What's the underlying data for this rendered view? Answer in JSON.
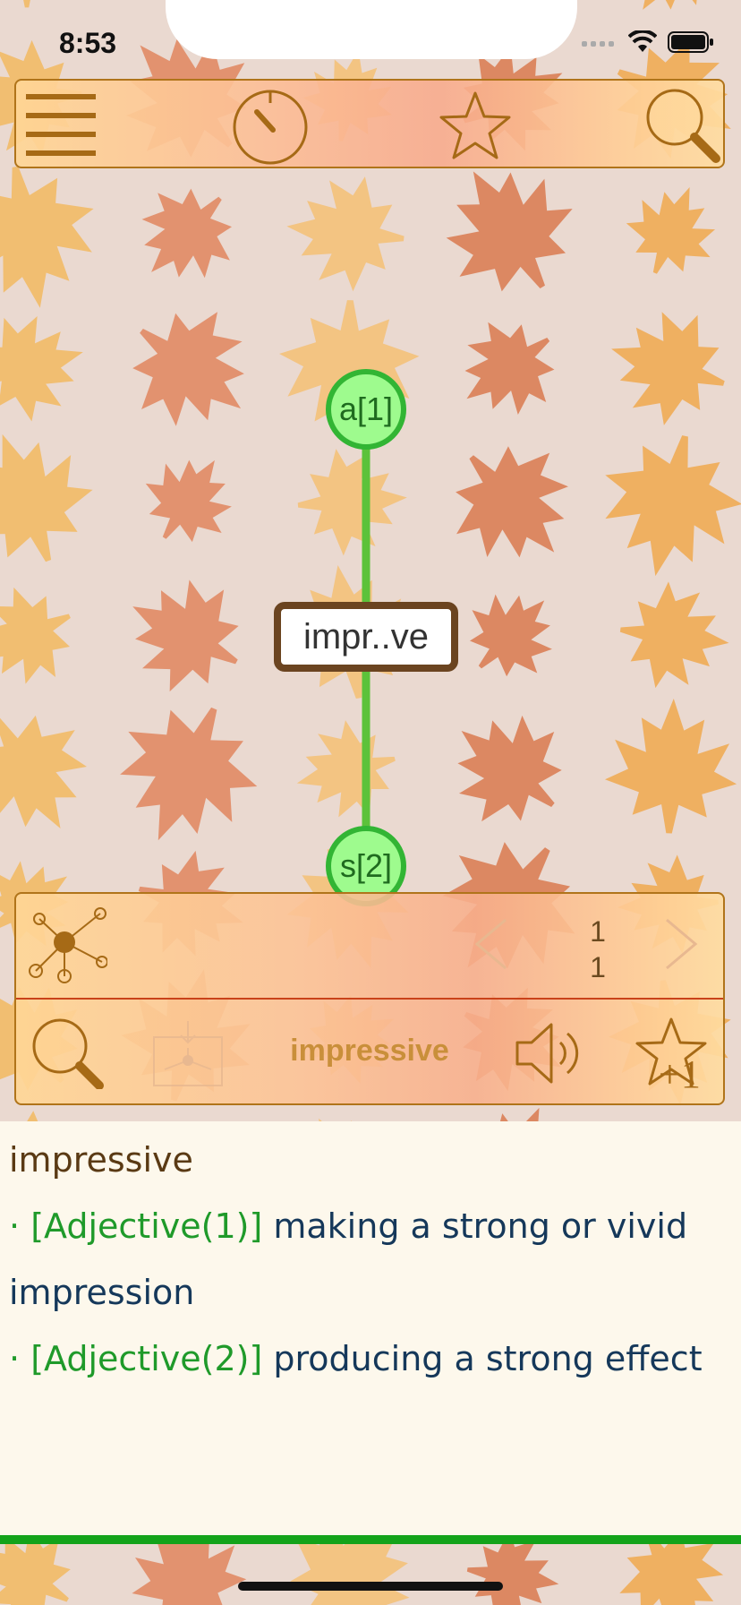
{
  "status_bar": {
    "time": "8:53"
  },
  "graph": {
    "nodes": [
      {
        "id": "a",
        "label": "a[1]"
      },
      {
        "id": "s",
        "label": "s[2]"
      }
    ],
    "center_word": "impr..ve"
  },
  "panel": {
    "counter_top": "1",
    "counter_bottom": "1",
    "current_word": "impressive"
  },
  "definition": {
    "word": "impressive",
    "bullet": "·",
    "senses": [
      {
        "pos": "[Adjective(1)]",
        "text": "making a strong or vivid impression"
      },
      {
        "pos": "[Adjective(2)]",
        "text": "producing a strong effect"
      }
    ]
  },
  "colors": {
    "accent": "#b0741a",
    "node_fill": "#9efb8e",
    "node_border": "#32b534",
    "pos_green": "#1f9a2a",
    "definition_text": "#15385a",
    "bottom_bar": "#13a31a"
  },
  "icons": {
    "menu": "hamburger-icon",
    "timer": "timer-icon",
    "favorites": "star-icon",
    "search": "search-icon",
    "graph": "network-graph-icon",
    "prev": "chevron-left-icon",
    "next": "chevron-right-icon",
    "import": "import-graph-icon",
    "speak": "speaker-icon",
    "add_favorite": "star-plus-one-icon"
  }
}
